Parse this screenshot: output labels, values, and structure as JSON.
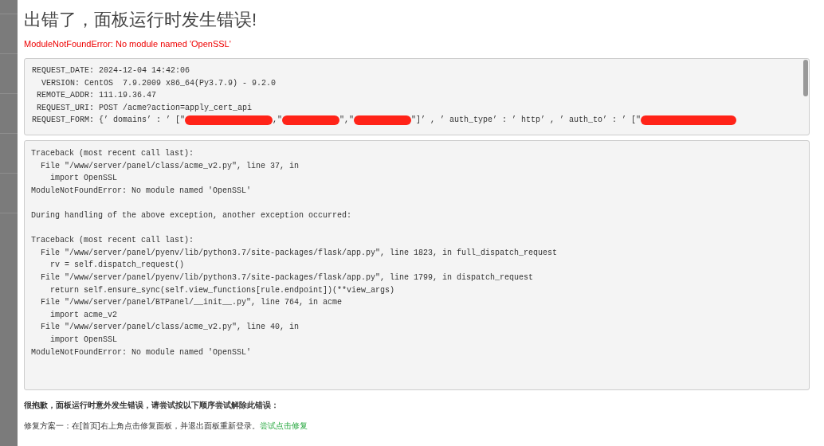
{
  "title": "出错了，面板运行时发生错误!",
  "error": "ModuleNotFoundError: No module named 'OpenSSL'",
  "request_info": {
    "lines": [
      "REQUEST_DATE: 2024-12-04 14:42:06",
      "  VERSION: CentOS  7.9.2009 x86_64(Py3.7.9) - 9.2.0",
      " REMOTE_ADDR: 111.19.36.47",
      " REQUEST_URI: POST /acme?action=apply_cert_api"
    ],
    "form_segments": [
      {
        "kind": "text",
        "text": "REQUEST_FORM: {’ domains’ : ’ [\""
      },
      {
        "kind": "redacted"
      },
      {
        "kind": "text",
        "text": ",\""
      },
      {
        "kind": "redacted"
      },
      {
        "kind": "text",
        "text": "\",\""
      },
      {
        "kind": "redacted"
      },
      {
        "kind": "text",
        "text": "\"]’ , ’ auth_type’ : ’ http’ , ’ auth_to’ : ’ [\""
      },
      {
        "kind": "redacted"
      }
    ]
  },
  "traceback": [
    [
      "Traceback (most recent call last):",
      "  File \"/www/server/panel/class/acme_v2.py\", line 37, in",
      "    import OpenSSL",
      "ModuleNotFoundError: No module named 'OpenSSL'"
    ],
    [
      "During handling of the above exception, another exception occurred:"
    ],
    [
      "Traceback (most recent call last):",
      "  File \"/www/server/panel/pyenv/lib/python3.7/site-packages/flask/app.py\", line 1823, in full_dispatch_request",
      "    rv = self.dispatch_request()",
      "  File \"/www/server/panel/pyenv/lib/python3.7/site-packages/flask/app.py\", line 1799, in dispatch_request",
      "    return self.ensure_sync(self.view_functions[rule.endpoint])(**view_args)",
      "  File \"/www/server/panel/BTPanel/__init__.py\", line 764, in acme",
      "    import acme_v2",
      "  File \"/www/server/panel/class/acme_v2.py\", line 40, in",
      "    import OpenSSL",
      "ModuleNotFoundError: No module named 'OpenSSL'"
    ]
  ],
  "help_heading": "很抱歉，面板运行时意外发生错误，请尝试按以下顺序尝试解除此错误：",
  "fix_one": {
    "text": "修复方案一：在[首页]右上角点击修复面板，并退出面板重新登录。",
    "link": "尝试点击修复"
  }
}
